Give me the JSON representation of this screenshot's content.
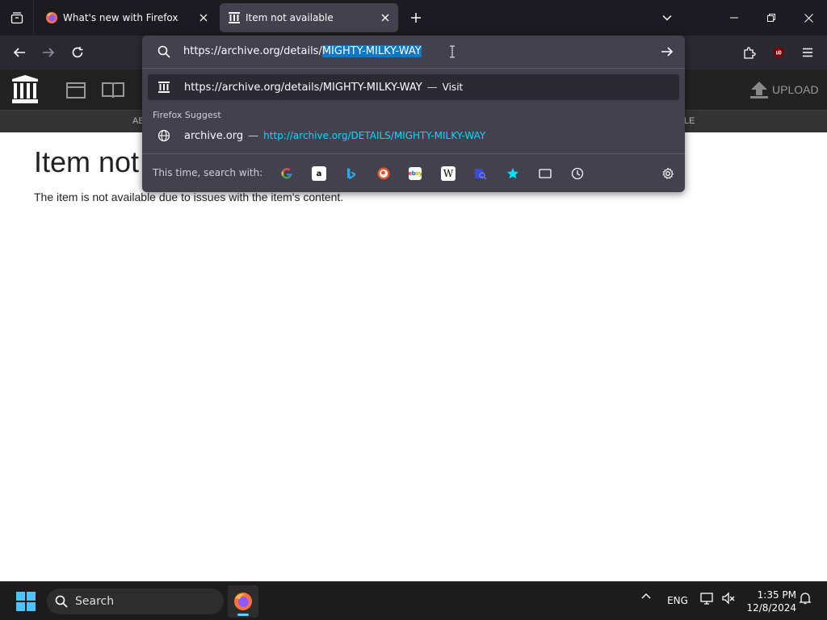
{
  "tabs": [
    {
      "title": "What's new with Firefox",
      "icon": "firefox-icon",
      "active": false
    },
    {
      "title": "Item not available",
      "icon": "archive-icon",
      "active": true
    }
  ],
  "urlbar": {
    "url_prefix": "https://archive.org/details/",
    "url_selected": "MIGHTY-MILKY-WAY"
  },
  "dropdown": {
    "top_row": {
      "url": "https://archive.org/details/MIGHTY-MILKY-WAY",
      "dash": "—",
      "action": "Visit"
    },
    "section_label": "Firefox Suggest",
    "suggestion": {
      "title": "archive.org",
      "dash": "—",
      "url": "http://archive.org/DETAILS/MIGHTY-MILKY-WAY"
    },
    "search_with_label": "This time, search with:",
    "engines": [
      "google",
      "amazon",
      "bing",
      "duckduckgo",
      "ebay",
      "wikipedia",
      "tab-search",
      "bookmarks",
      "tabs",
      "history"
    ]
  },
  "page": {
    "nav_partial_left": "AB",
    "nav_partial_right": "LE",
    "upload_label": "UPLOAD",
    "title": "Item not",
    "message": "The item is not available due to issues with the item's content."
  },
  "taskbar": {
    "search_label": "Search",
    "lang": "ENG",
    "time": "1:35 PM",
    "date": "12/8/2024"
  },
  "colors": {
    "accent": "#00ddff",
    "selection": "#0c79c8",
    "toolbar": "#2b2a33",
    "panel": "#42414d"
  }
}
